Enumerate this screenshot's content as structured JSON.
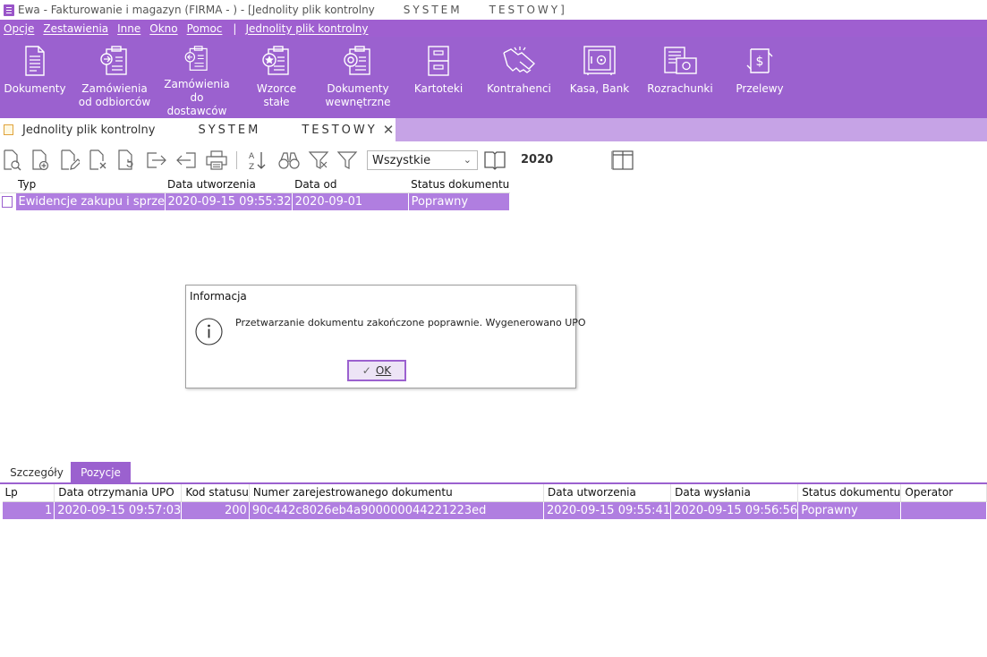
{
  "window": {
    "title": "Ewa - Fakturowanie i magazyn (FIRMA - ) - [Jednolity plik kontrolny",
    "title_system": "SYSTEM",
    "title_testowy": "TESTOWY]"
  },
  "menu": [
    "Opcje",
    "Zestawienia",
    "Inne",
    "Okno",
    "Pomoc"
  ],
  "menu_separator": "|",
  "menu_extra": "Jednolity plik kontrolny",
  "ribbon": [
    {
      "label": "Dokumenty",
      "icon": "document-icon"
    },
    {
      "label": "Zamówienia\nod odbiorców",
      "icon": "order-in-icon"
    },
    {
      "label": "Zamówienia\ndo dostawców",
      "icon": "order-out-icon"
    },
    {
      "label": "Wzorce\nstałe",
      "icon": "template-icon"
    },
    {
      "label": "Dokumenty\nwewnętrzne",
      "icon": "internal-doc-icon"
    },
    {
      "label": "Kartoteki",
      "icon": "cabinet-icon"
    },
    {
      "label": "Kontrahenci",
      "icon": "handshake-icon"
    },
    {
      "label": "Kasa, Bank",
      "icon": "safe-icon"
    },
    {
      "label": "Rozrachunki",
      "icon": "settlements-icon"
    },
    {
      "label": "Przelewy",
      "icon": "transfer-icon"
    }
  ],
  "doc_tab": {
    "label": "Jednolity plik kontrolny",
    "system": "SYSTEM",
    "testowy": "TESTOWY",
    "close": "✕"
  },
  "toolbar": {
    "filter_value": "Wszystkie",
    "year": "2020",
    "icons": [
      "preview-icon",
      "add-document-icon",
      "edit-document-icon",
      "delete-document-icon",
      "refresh-document-icon",
      "export-icon",
      "import-icon",
      "print-icon",
      "sort-az-icon",
      "binoculars-icon",
      "filter-clear-icon",
      "filter-icon",
      "book-icon",
      "columns-icon"
    ]
  },
  "top_grid": {
    "headers": [
      "Typ",
      "Data utworzenia",
      "Data od",
      "Status dokumentu"
    ],
    "rows": [
      [
        "Ewidencje zakupu i sprzedaży",
        "2020-09-15 09:55:32",
        "2020-09-01",
        "Poprawny"
      ]
    ]
  },
  "dialog": {
    "title": "Informacja",
    "message": "Przetwarzanie dokumentu zakończone poprawnie. Wygenerowano UPO",
    "ok_label": "OK"
  },
  "bottom_tabs": [
    "Szczegóły",
    "Pozycje"
  ],
  "bottom_grid": {
    "headers": [
      "Lp",
      "Data otrzymania UPO",
      "Kod statusu",
      "Numer zarejestrowanego dokumentu",
      "Data utworzenia",
      "Data wysłania",
      "Status dokumentu",
      "Operator"
    ],
    "rows": [
      [
        "1",
        "2020-09-15 09:57:03",
        "200",
        "90c442c8026eb4a900000044221223ed",
        "2020-09-15 09:55:41",
        "2020-09-15 09:56:56",
        "Poprawny",
        ""
      ]
    ]
  },
  "colors": {
    "accent": "#9b61cf",
    "selection": "#b07ee0",
    "tabstrip": "#c6a3e6"
  }
}
